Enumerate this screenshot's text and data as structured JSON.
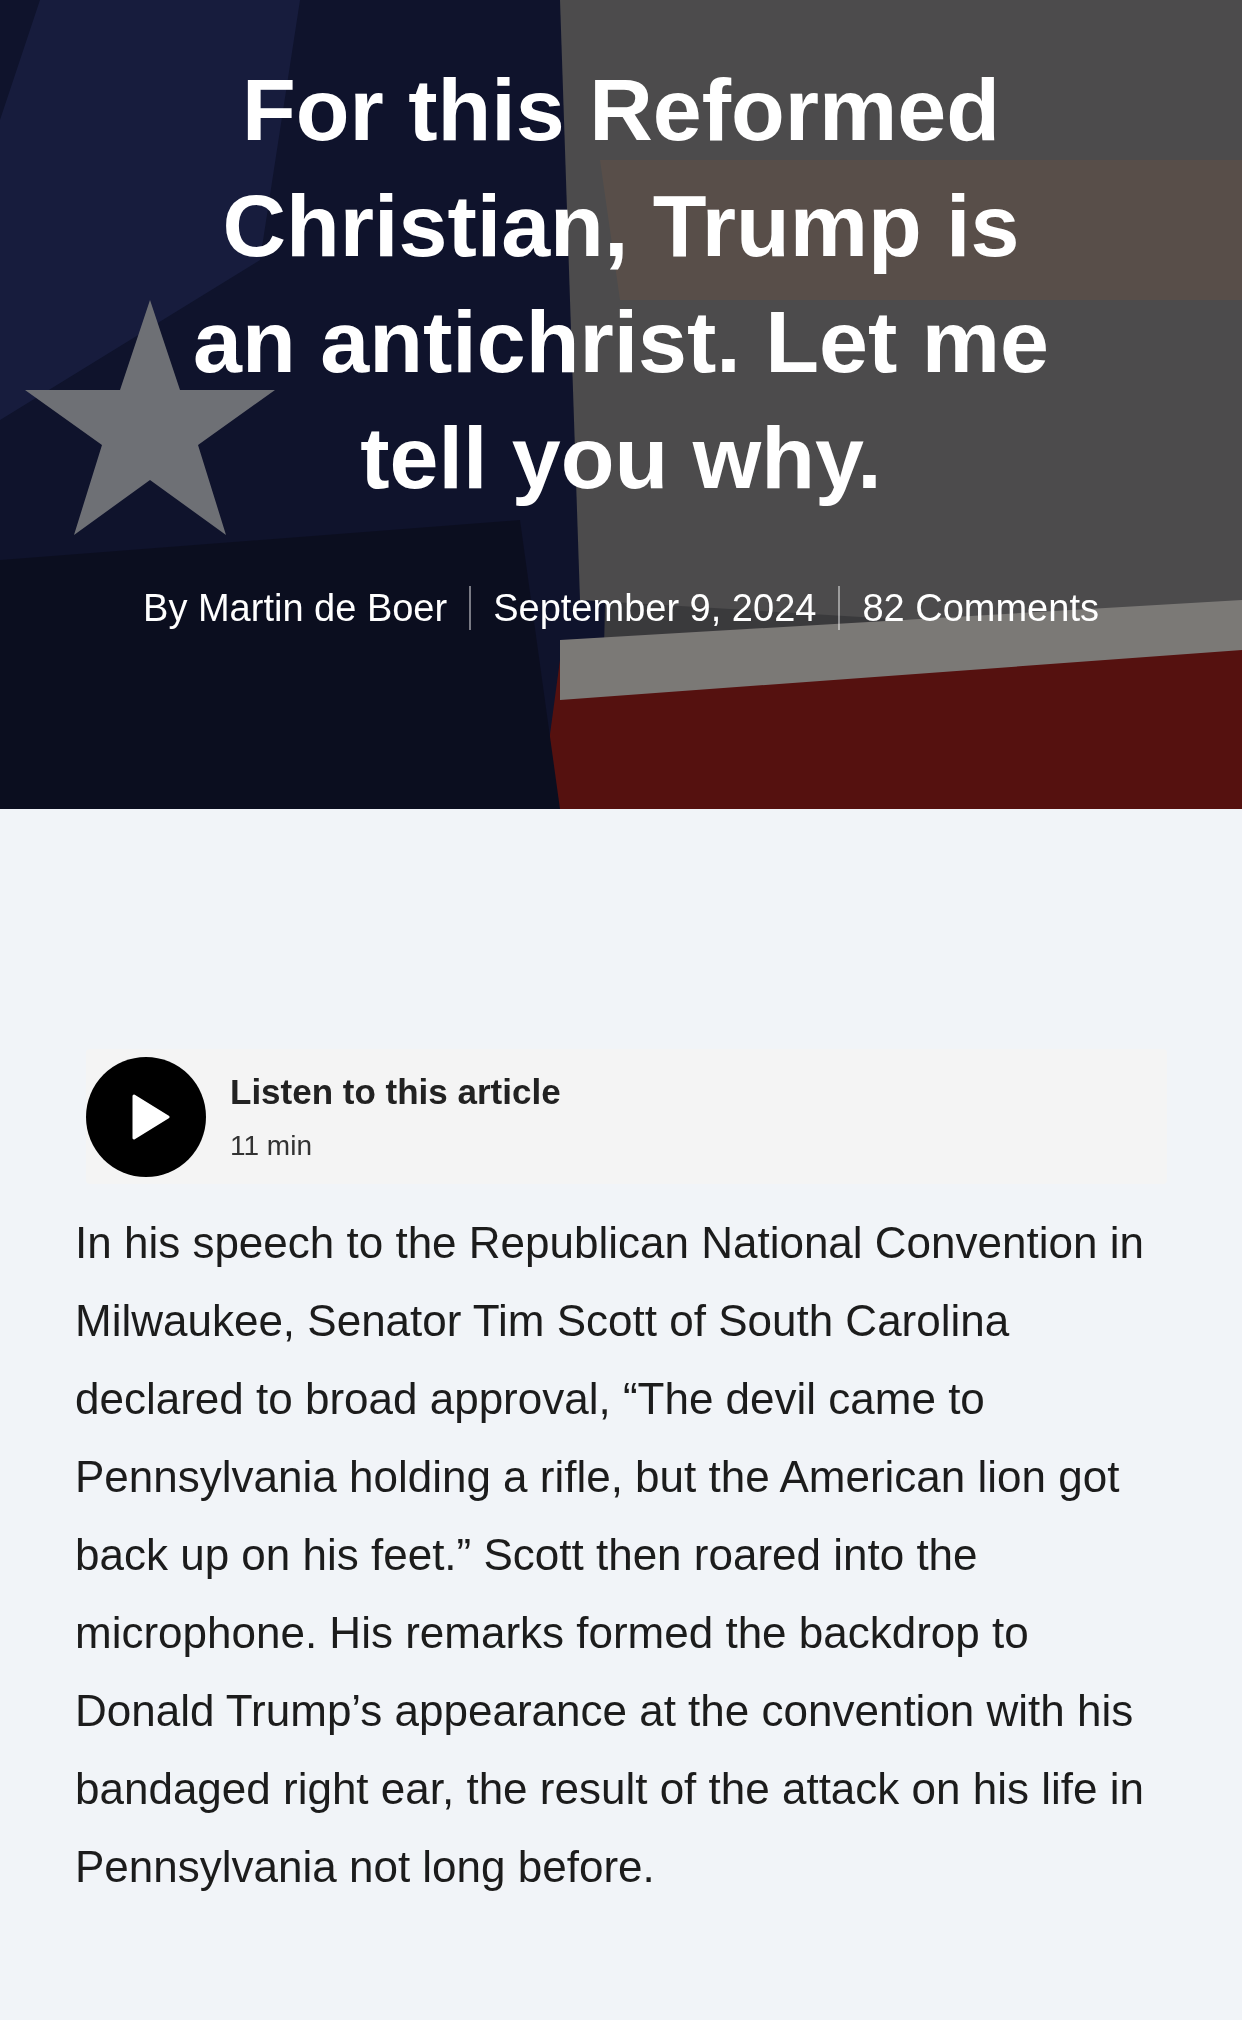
{
  "hero": {
    "title": "For this Reformed Christian, Trump is an antichrist. Let me tell you why.",
    "meta": [
      "By Martin de Boer",
      "September 9, 2024",
      "82 Comments"
    ]
  },
  "audio_player": {
    "label": "Listen to this article",
    "duration": "11 min"
  },
  "article": {
    "paragraphs": [
      "In his speech to the Republican National Convention in Milwaukee, Senator Tim Scott of South Carolina declared to broad approval, “The devil came to Pennsylvania holding a rifle, but the American lion got back up on his feet.” Scott then roared into the microphone. His remarks formed the backdrop to Donald Trump’s appearance at the convention with his bandaged right ear, the result of the attack on his life in Pennsylvania not long before."
    ]
  }
}
